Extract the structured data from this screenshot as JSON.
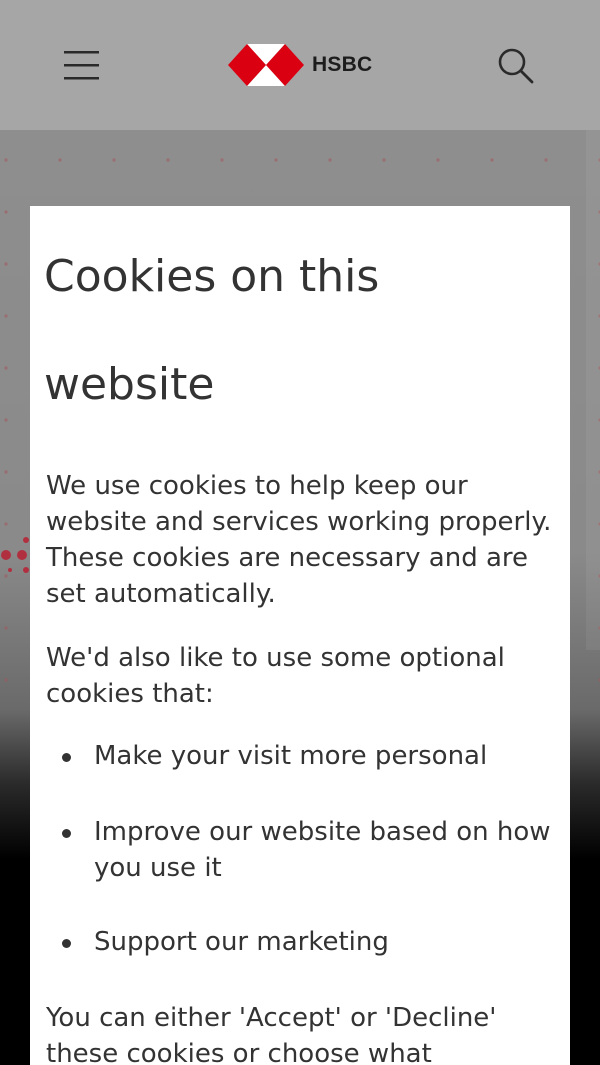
{
  "header": {
    "brand": "HSBC",
    "menu_icon": "hamburger-menu-icon",
    "search_icon": "search-icon"
  },
  "colors": {
    "brand_red": "#db0011",
    "overlay_gray": "#a6a6a6",
    "text_dark": "#333333"
  },
  "modal": {
    "title_line1": "Cookies on this",
    "title_line2": "website",
    "intro": "We use cookies to help keep our website and services working properly. These cookies are necessary and are set automatically.",
    "optional_intro": "We'd also like to use some optional cookies that:",
    "bullets": [
      "Make your visit more personal",
      "Improve our website based on how you use it",
      "Support our marketing"
    ],
    "choice_text": "You can either 'Accept' or 'Decline' these cookies or choose what"
  }
}
